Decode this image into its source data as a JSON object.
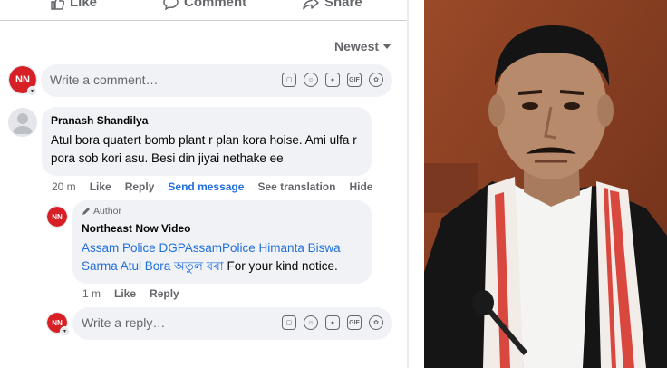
{
  "actions": {
    "like": "Like",
    "comment": "Comment",
    "share": "Share"
  },
  "sort": {
    "label": "Newest"
  },
  "composer": {
    "placeholder": "Write a comment…"
  },
  "comment1": {
    "author": "Pranash Shandilya",
    "text": "Atul bora quatert bomb plant r plan kora hoise. Ami ulfa r pora sob kori asu. Besi din jiyai nethake ee",
    "time": "20 m",
    "like": "Like",
    "reply": "Reply",
    "send_message": "Send message",
    "see_translation": "See translation",
    "hide": "Hide"
  },
  "reply1": {
    "badge": "Author",
    "author": "Northeast Now Video",
    "link_text": "Assam Police DGPAssamPolice Himanta Biswa Sarma Atul Bora অতুল বৰা",
    "text": " For your kind notice.",
    "time": "1 m",
    "like": "Like",
    "reply": "Reply"
  },
  "reply_composer": {
    "placeholder": "Write a reply…"
  },
  "brand": {
    "logo_text": "NN",
    "color": "#d71f26"
  },
  "colors": {
    "link": "#216fdb",
    "bubble": "#f0f2f5",
    "muted": "#65676b"
  },
  "icons": [
    "like-icon",
    "comment-icon",
    "share-icon",
    "sticker-icon",
    "emoji-icon",
    "camera-icon",
    "gif-icon",
    "avatar-sticker-icon",
    "pencil-icon",
    "caret-down-icon"
  ]
}
